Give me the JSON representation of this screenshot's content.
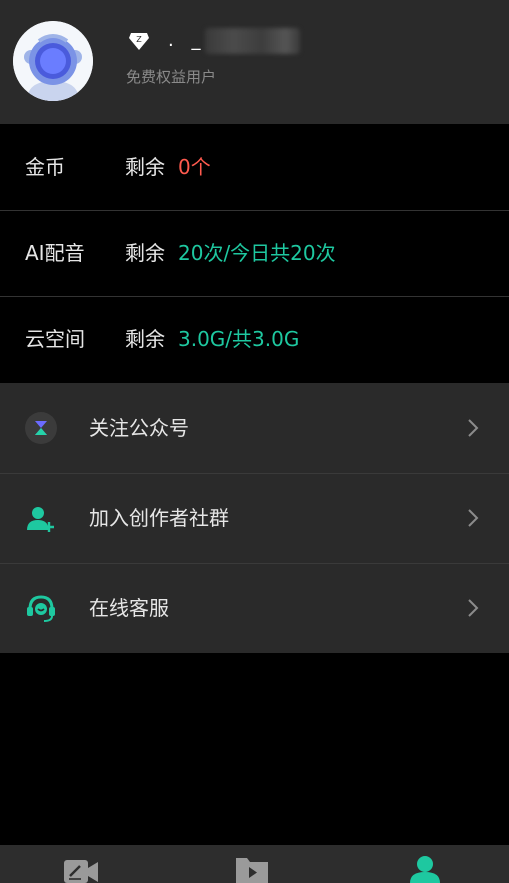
{
  "colors": {
    "accent": "#1ec8a0",
    "warning": "#ff5a4e",
    "panel": "#2a2a2a",
    "background": "#000000"
  },
  "profile": {
    "avatar_icon": "robot-avatar",
    "badge_icon": "diamond-icon",
    "username_visible": ". _",
    "subtitle": "免费权益用户"
  },
  "quotas": [
    {
      "label": "金币",
      "prefix": "剩余",
      "value": "0个",
      "value_color": "#ff5a4e"
    },
    {
      "label": "AI配音",
      "prefix": "剩余",
      "value": "20次/今日共20次",
      "value_color": "#1ec8a0"
    },
    {
      "label": "云空间",
      "prefix": "剩余",
      "value": "3.0G/共3.0G",
      "value_color": "#1ec8a0"
    }
  ],
  "menu": [
    {
      "label": "关注公众号",
      "icon": "official-account-icon"
    },
    {
      "label": "加入创作者社群",
      "icon": "add-user-icon"
    },
    {
      "label": "在线客服",
      "icon": "headset-icon"
    }
  ],
  "tabs": [
    {
      "icon": "edit-video-icon",
      "active": false
    },
    {
      "icon": "folder-play-icon",
      "active": false
    },
    {
      "icon": "user-icon",
      "active": true
    }
  ]
}
